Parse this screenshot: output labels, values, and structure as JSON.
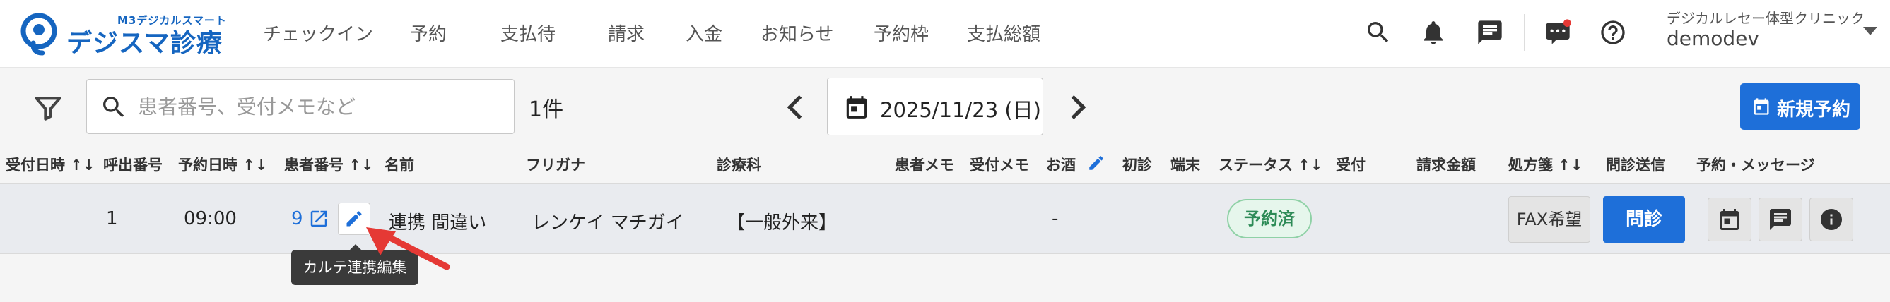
{
  "logo": {
    "sub": "M3デジカルスマート",
    "main": "デジスマ診療"
  },
  "nav": [
    "チェックイン",
    "予約",
    "支払待",
    "請求",
    "入金",
    "お知らせ",
    "予約枠",
    "支払総額"
  ],
  "user": {
    "clinic": "デジカルレセー体型クリニック",
    "name": "demodev"
  },
  "toolbar": {
    "search_placeholder": "患者番号、受付メモなど",
    "count": "1件",
    "date": "2025/11/23 (日)",
    "new_button": "新規予約"
  },
  "table": {
    "headers": [
      "受付日時 ↑↓",
      "呼出番号",
      "予約日時 ↑↓",
      "患者番号 ↑↓",
      "名前",
      "フリガナ",
      "診療科",
      "患者メモ",
      "受付メモ",
      "お酒",
      "初診",
      "端末",
      "ステータス ↑↓",
      "受付",
      "請求金額",
      "処方箋 ↑↓",
      "問診送信",
      "予約・メッセージ"
    ],
    "row": {
      "call_number": "1",
      "reservation_time": "09:00",
      "patient_number": "9",
      "name": "連携 間違い",
      "furigana": "レンケイ マチガイ",
      "department": "【一般外来】",
      "sake": "-",
      "status": "予約済",
      "prescription": "FAX希望",
      "inquiry": "問診"
    }
  },
  "tooltip": "カルテ連携編集",
  "colors": {
    "brand": "#1565c0",
    "primary": "#1e6fd9",
    "status_green": "#2e8b57",
    "annotation_arrow": "#e53935"
  }
}
